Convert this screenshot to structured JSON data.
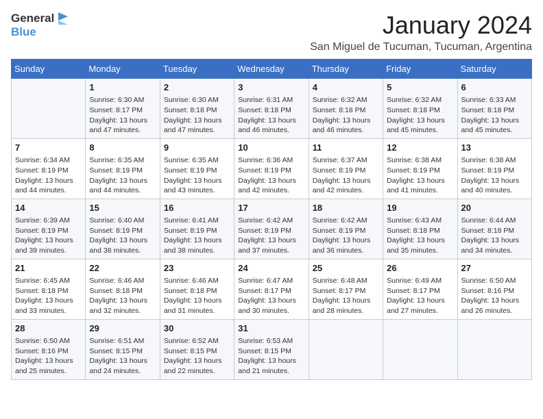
{
  "logo": {
    "general": "General",
    "blue": "Blue"
  },
  "title": "January 2024",
  "subtitle": "San Miguel de Tucuman, Tucuman, Argentina",
  "days_of_week": [
    "Sunday",
    "Monday",
    "Tuesday",
    "Wednesday",
    "Thursday",
    "Friday",
    "Saturday"
  ],
  "weeks": [
    [
      {
        "day": "",
        "content": ""
      },
      {
        "day": "1",
        "content": "Sunrise: 6:30 AM\nSunset: 8:17 PM\nDaylight: 13 hours\nand 47 minutes."
      },
      {
        "day": "2",
        "content": "Sunrise: 6:30 AM\nSunset: 8:18 PM\nDaylight: 13 hours\nand 47 minutes."
      },
      {
        "day": "3",
        "content": "Sunrise: 6:31 AM\nSunset: 8:18 PM\nDaylight: 13 hours\nand 46 minutes."
      },
      {
        "day": "4",
        "content": "Sunrise: 6:32 AM\nSunset: 8:18 PM\nDaylight: 13 hours\nand 46 minutes."
      },
      {
        "day": "5",
        "content": "Sunrise: 6:32 AM\nSunset: 8:18 PM\nDaylight: 13 hours\nand 45 minutes."
      },
      {
        "day": "6",
        "content": "Sunrise: 6:33 AM\nSunset: 8:18 PM\nDaylight: 13 hours\nand 45 minutes."
      }
    ],
    [
      {
        "day": "7",
        "content": "Sunrise: 6:34 AM\nSunset: 8:19 PM\nDaylight: 13 hours\nand 44 minutes."
      },
      {
        "day": "8",
        "content": "Sunrise: 6:35 AM\nSunset: 8:19 PM\nDaylight: 13 hours\nand 44 minutes."
      },
      {
        "day": "9",
        "content": "Sunrise: 6:35 AM\nSunset: 8:19 PM\nDaylight: 13 hours\nand 43 minutes."
      },
      {
        "day": "10",
        "content": "Sunrise: 6:36 AM\nSunset: 8:19 PM\nDaylight: 13 hours\nand 42 minutes."
      },
      {
        "day": "11",
        "content": "Sunrise: 6:37 AM\nSunset: 8:19 PM\nDaylight: 13 hours\nand 42 minutes."
      },
      {
        "day": "12",
        "content": "Sunrise: 6:38 AM\nSunset: 8:19 PM\nDaylight: 13 hours\nand 41 minutes."
      },
      {
        "day": "13",
        "content": "Sunrise: 6:38 AM\nSunset: 8:19 PM\nDaylight: 13 hours\nand 40 minutes."
      }
    ],
    [
      {
        "day": "14",
        "content": "Sunrise: 6:39 AM\nSunset: 8:19 PM\nDaylight: 13 hours\nand 39 minutes."
      },
      {
        "day": "15",
        "content": "Sunrise: 6:40 AM\nSunset: 8:19 PM\nDaylight: 13 hours\nand 38 minutes."
      },
      {
        "day": "16",
        "content": "Sunrise: 6:41 AM\nSunset: 8:19 PM\nDaylight: 13 hours\nand 38 minutes."
      },
      {
        "day": "17",
        "content": "Sunrise: 6:42 AM\nSunset: 8:19 PM\nDaylight: 13 hours\nand 37 minutes."
      },
      {
        "day": "18",
        "content": "Sunrise: 6:42 AM\nSunset: 8:19 PM\nDaylight: 13 hours\nand 36 minutes."
      },
      {
        "day": "19",
        "content": "Sunrise: 6:43 AM\nSunset: 8:18 PM\nDaylight: 13 hours\nand 35 minutes."
      },
      {
        "day": "20",
        "content": "Sunrise: 6:44 AM\nSunset: 8:18 PM\nDaylight: 13 hours\nand 34 minutes."
      }
    ],
    [
      {
        "day": "21",
        "content": "Sunrise: 6:45 AM\nSunset: 8:18 PM\nDaylight: 13 hours\nand 33 minutes."
      },
      {
        "day": "22",
        "content": "Sunrise: 6:46 AM\nSunset: 8:18 PM\nDaylight: 13 hours\nand 32 minutes."
      },
      {
        "day": "23",
        "content": "Sunrise: 6:46 AM\nSunset: 8:18 PM\nDaylight: 13 hours\nand 31 minutes."
      },
      {
        "day": "24",
        "content": "Sunrise: 6:47 AM\nSunset: 8:17 PM\nDaylight: 13 hours\nand 30 minutes."
      },
      {
        "day": "25",
        "content": "Sunrise: 6:48 AM\nSunset: 8:17 PM\nDaylight: 13 hours\nand 28 minutes."
      },
      {
        "day": "26",
        "content": "Sunrise: 6:49 AM\nSunset: 8:17 PM\nDaylight: 13 hours\nand 27 minutes."
      },
      {
        "day": "27",
        "content": "Sunrise: 6:50 AM\nSunset: 8:16 PM\nDaylight: 13 hours\nand 26 minutes."
      }
    ],
    [
      {
        "day": "28",
        "content": "Sunrise: 6:50 AM\nSunset: 8:16 PM\nDaylight: 13 hours\nand 25 minutes."
      },
      {
        "day": "29",
        "content": "Sunrise: 6:51 AM\nSunset: 8:15 PM\nDaylight: 13 hours\nand 24 minutes."
      },
      {
        "day": "30",
        "content": "Sunrise: 6:52 AM\nSunset: 8:15 PM\nDaylight: 13 hours\nand 22 minutes."
      },
      {
        "day": "31",
        "content": "Sunrise: 6:53 AM\nSunset: 8:15 PM\nDaylight: 13 hours\nand 21 minutes."
      },
      {
        "day": "",
        "content": ""
      },
      {
        "day": "",
        "content": ""
      },
      {
        "day": "",
        "content": ""
      }
    ]
  ]
}
